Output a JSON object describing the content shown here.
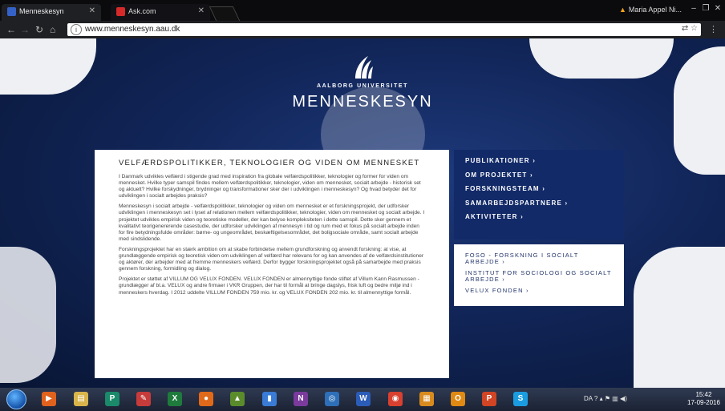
{
  "browser": {
    "tabs": [
      {
        "title": "Menneskesyn",
        "active": true
      },
      {
        "title": "Ask.com",
        "active": false
      }
    ],
    "profile_name": "Maria Appel Ni...",
    "url": "www.menneskesyn.aau.dk"
  },
  "header": {
    "university": "AALBORG UNIVERSITET",
    "title": "MENNESKESYN"
  },
  "article": {
    "heading": "VELFÆRDSPOLITIKKER, TEKNOLOGIER OG VIDEN OM MENNESKET",
    "paragraphs": [
      "I Danmark udvikles velfærd i stigende grad med inspiration fra globale velfærdspolitikker, teknologier og former for viden om mennesket. Hvilke typer samspil findes mellem velfærdspolitikker, teknologier, viden om mennesket, socialt arbejde - historisk set og aktuelt? Hvilke forskydninger, brydninger og transformationer sker der i udviklingen i menneskesyn? Og hvad betyder det for udviklingen i socialt arbejdes praksis?",
      "Menneskesyn i socialt arbejde - velfærdspolitikker, teknologier og viden om mennesket er et forskningsprojekt, der udforsker udviklingen i menneskesyn set i lyset af relationen mellem velfærdspolitikker, teknologier, viden om mennesket og socialt arbejde. I projektet udvikles empirisk viden og teoretiske modeller, der kan belyse kompleksiteten i dette samspil. Dette sker gennem et kvalitativt teorigenererende casestudie, der udforsker udviklingen af mennesyn i tid og rum med et fokus på socialt arbejde inden for fire betydningsfulde områder: børne- og ungeområdet, beskæftigelsesområdet, det boligsociale område, samt socialt arbejde med sindslidende.",
      "Forskningsprojektet har en stærk ambition om at skabe forbindelse mellem grundforskning og anvendt forskning: at vise, at grundlæggende empirisk og teoretisk viden om udviklingen af velfærd har relevans for og kan anvendes af de velfærdsinstitutioner og aktører, der arbejder med at fremme menneskers velfærd. Derfor bygger forskningsprojektet også på samarbejde med praksis gennem forskning, formidling og dialog.",
      "Projektet er støttet af VILLUM OG VELUX FONDEN. VELUX FONDEN er almennyttige fonde stiftet af Villum Kann Rasmussen - grundlægger af bl.a. VELUX og andre firmaer i VKR Gruppen, der har til formål at bringe dagslys, frisk luft og bedre miljø ind i menneskers hverdag. I 2012 uddelte VILLUM FONDEN 759 mio. kr. og VELUX FONDEN 202 mio. kr. til almennyttige formål."
    ]
  },
  "nav": {
    "items": [
      "PUBLIKATIONER ›",
      "OM PROJEKTET ›",
      "FORSKNINGSTEAM ›",
      "SAMARBEJDSPARTNERE ›",
      "AKTIVITETER ›"
    ]
  },
  "links": {
    "items": [
      "FOSO - FORSKNING I SOCIALT ARBEJDE ›",
      "INSTITUT FOR SOCIOLOGI OG SOCIALT ARBEJDE ›",
      "VELUX FONDEN ›"
    ]
  },
  "taskbar": {
    "apps": [
      {
        "icon": "media-player-icon",
        "glyph": "▶",
        "color": "#e0621d"
      },
      {
        "icon": "file-explorer-icon",
        "glyph": "▤",
        "color": "#d9b44a"
      },
      {
        "icon": "publisher-icon",
        "glyph": "P",
        "color": "#1a8a6a"
      },
      {
        "icon": "paint-icon",
        "glyph": "✎",
        "color": "#c73b3b"
      },
      {
        "icon": "excel-icon",
        "glyph": "X",
        "color": "#1e7b3c"
      },
      {
        "icon": "firefox-icon",
        "glyph": "●",
        "color": "#e06a1a"
      },
      {
        "icon": "photo-viewer-icon",
        "glyph": "▲",
        "color": "#5b8c2c"
      },
      {
        "icon": "folder-icon",
        "glyph": "▮",
        "color": "#3a7bd5"
      },
      {
        "icon": "onenote-icon",
        "glyph": "N",
        "color": "#7a3b9c"
      },
      {
        "icon": "network-icon",
        "glyph": "◎",
        "color": "#2d6fb8"
      },
      {
        "icon": "word-icon",
        "glyph": "W",
        "color": "#2b5cb8"
      },
      {
        "icon": "chrome-icon",
        "glyph": "◉",
        "color": "#d8402f"
      },
      {
        "icon": "apps-icon",
        "glyph": "▦",
        "color": "#d98b1e"
      },
      {
        "icon": "outlook-icon",
        "glyph": "O",
        "color": "#e08a14"
      },
      {
        "icon": "powerpoint-icon",
        "glyph": "P",
        "color": "#d14424"
      },
      {
        "icon": "skype-icon",
        "glyph": "S",
        "color": "#1a9de0"
      }
    ],
    "language": "DA",
    "time": "15:42",
    "date": "17-09-2016"
  }
}
